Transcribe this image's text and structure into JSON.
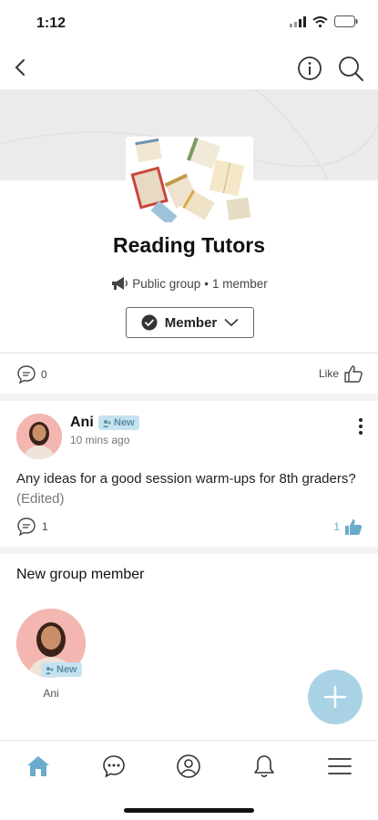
{
  "status_bar": {
    "time": "1:12"
  },
  "group": {
    "name": "Reading Tutors",
    "visibility": "Public group",
    "separator": "•",
    "member_count": "1 member",
    "membership_label": "Member"
  },
  "reactions": {
    "comment_count": "0",
    "like_label": "Like"
  },
  "post": {
    "author": "Ani",
    "badge": "New",
    "time": "10 mins ago",
    "text": "Any ideas for a good session warm-ups for 8th graders?",
    "edited": "(Edited)",
    "comment_count": "1",
    "like_count": "1"
  },
  "new_member_section": {
    "title": "New group member",
    "members": [
      {
        "name": "Ani",
        "badge": "New"
      }
    ]
  },
  "icons": {
    "back": "chevron-left-icon",
    "info": "info-icon",
    "search": "search-icon",
    "megaphone": "megaphone-icon",
    "check": "check-circle-icon",
    "chevron": "chevron-down-icon",
    "comment": "comment-icon",
    "like": "thumbs-up-icon",
    "more": "more-vertical-icon",
    "add": "plus-icon",
    "tabs": [
      "home-icon",
      "chat-icon",
      "profile-icon",
      "bell-icon",
      "menu-icon"
    ]
  },
  "colors": {
    "accent": "#6aaccb",
    "badge_bg": "#c5e3ef",
    "fab": "#a9d3e4",
    "cover": "#ebebeb"
  }
}
